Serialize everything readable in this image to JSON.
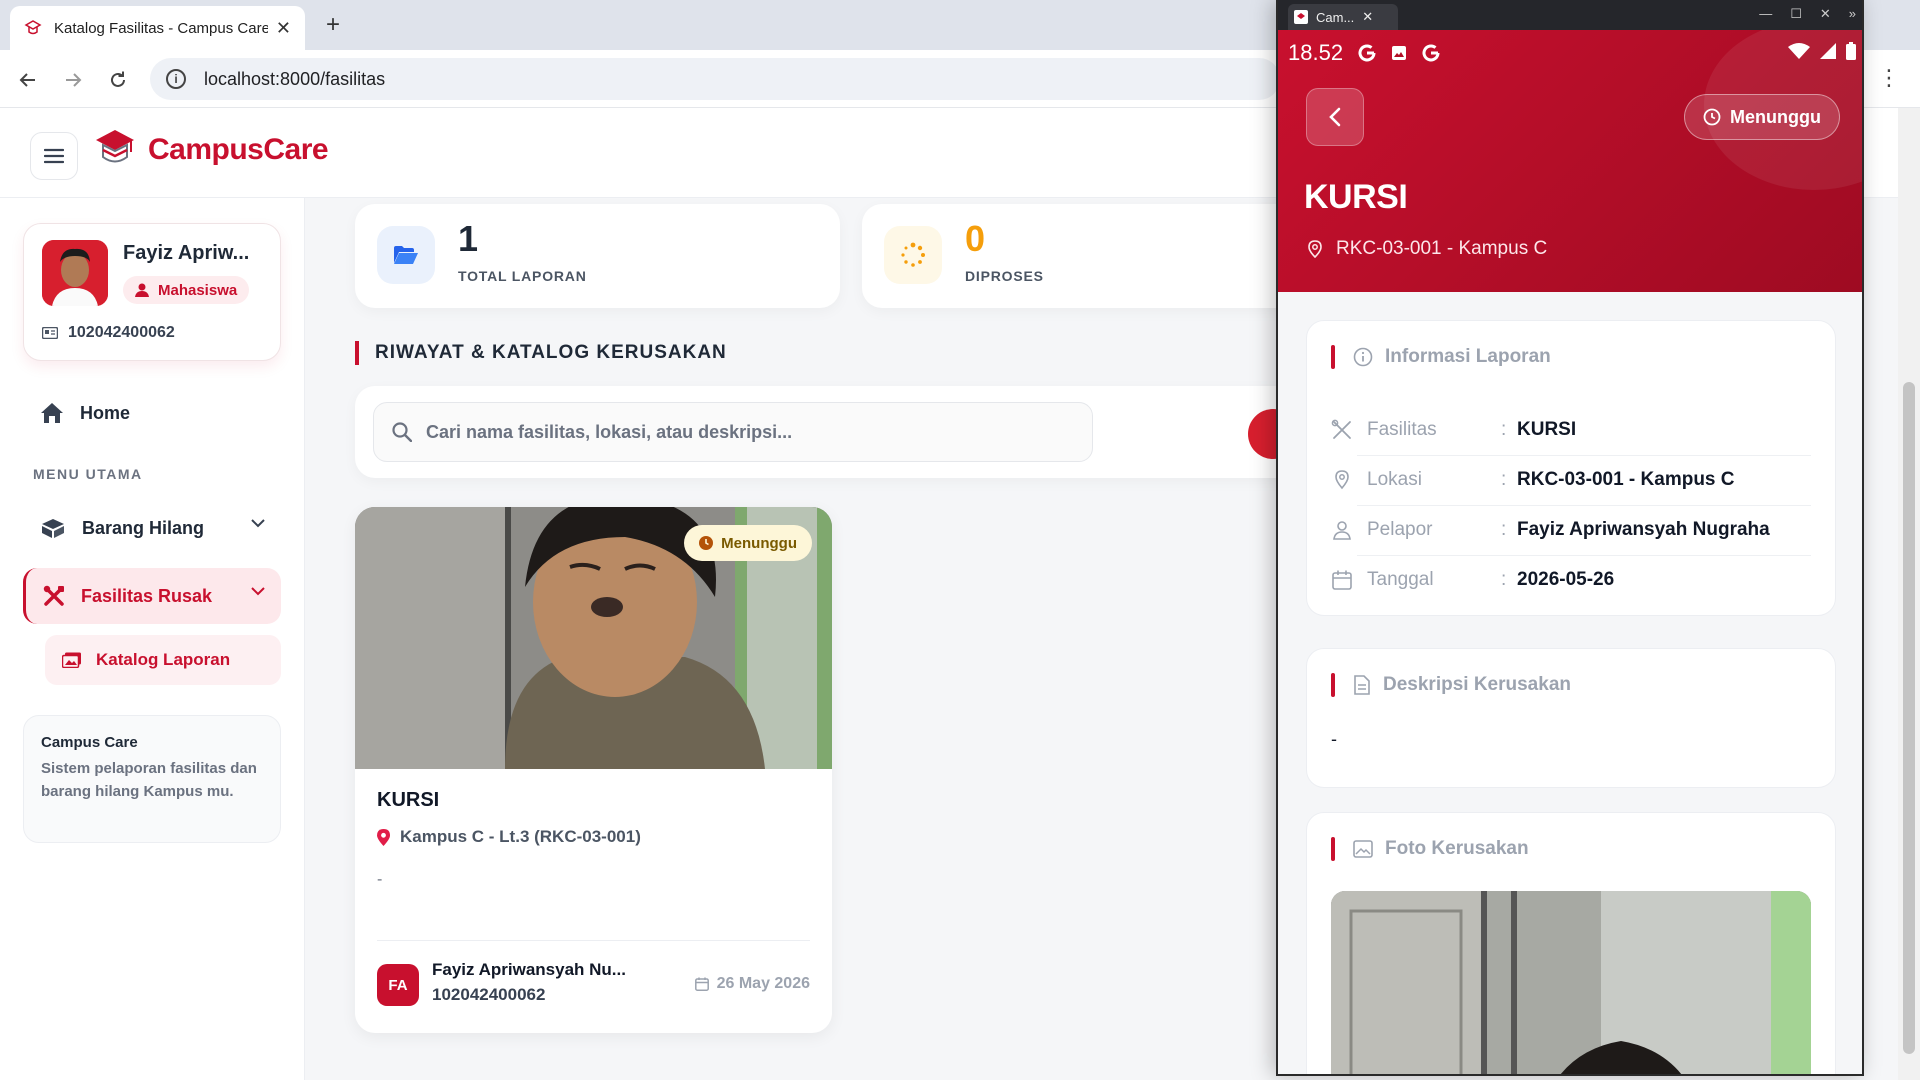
{
  "browser": {
    "tab_title": "Katalog Fasilitas - Campus Care",
    "url": "localhost:8000/fasilitas"
  },
  "brand": {
    "name": "CampusCare",
    "accent": "#c8102e"
  },
  "profile": {
    "name": "Fayiz Apriw...",
    "role": "Mahasiswa",
    "nim": "102042400062"
  },
  "sidebar": {
    "home": "Home",
    "menu_label": "MENU UTAMA",
    "barang_hilang": "Barang Hilang",
    "fasilitas_rusak": "Fasilitas Rusak",
    "katalog_laporan": "Katalog Laporan",
    "info_title": "Campus Care",
    "info_text": "Sistem pelaporan fasilitas dan barang hilang Kampus mu."
  },
  "stats": [
    {
      "value": "1",
      "label": "TOTAL LAPORAN",
      "color": "#1f2937"
    },
    {
      "value": "0",
      "label": "DIPROSES",
      "color": "#f59e0b"
    }
  ],
  "section_title": "RIWAYAT & KATALOG KERUSAKAN",
  "search": {
    "placeholder": "Cari nama fasilitas, lokasi, atau deskripsi..."
  },
  "card": {
    "status": "Menunggu",
    "title": "KURSI",
    "location": "Kampus C - Lt.3 (RKC-03-001)",
    "description": "-",
    "avatar_initials": "FA",
    "reporter": "Fayiz Apriwansyah Nu...",
    "reporter_nim": "102042400062",
    "date": "26 May 2026"
  },
  "phone": {
    "window_tab": "Cam...",
    "time": "18.52",
    "status_badge": "Menunggu",
    "title": "KURSI",
    "location": "RKC-03-001 - Kampus C",
    "info_header": "Informasi Laporan",
    "fields": [
      {
        "key": "Fasilitas",
        "value": "KURSI",
        "icon": "tools-icon"
      },
      {
        "key": "Lokasi",
        "value": "RKC-03-001 - Kampus C",
        "icon": "pin-icon"
      },
      {
        "key": "Pelapor",
        "value": "Fayiz Apriwansyah Nugraha",
        "icon": "user-icon"
      },
      {
        "key": "Tanggal",
        "value": "2026-05-26",
        "icon": "calendar-icon"
      }
    ],
    "desc_header": "Deskripsi Kerusakan",
    "desc_value": "-",
    "photo_header": "Foto Kerusakan"
  }
}
